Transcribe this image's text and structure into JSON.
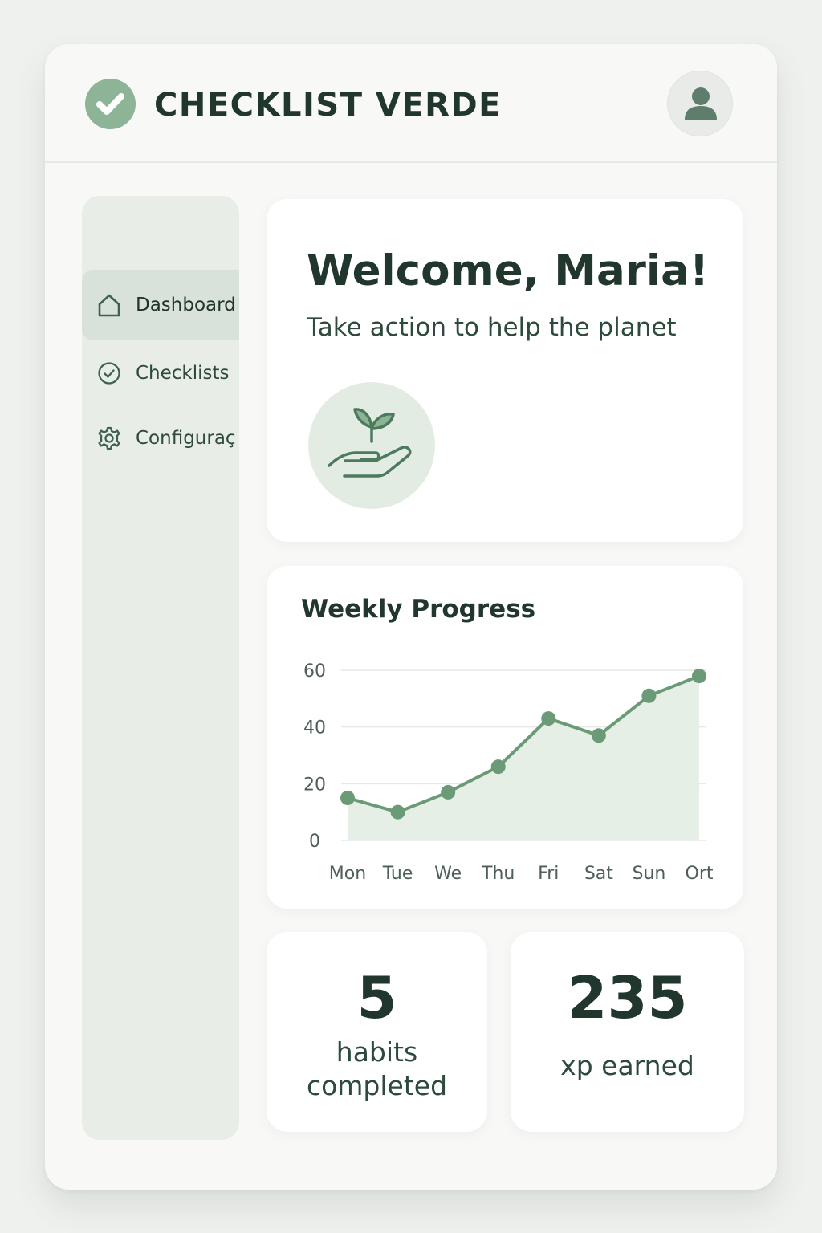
{
  "header": {
    "title": "CHECKLIST VERDE",
    "logo_icon": "check-circle-icon",
    "avatar_icon": "user-icon"
  },
  "sidebar": {
    "items": [
      {
        "label": "Dashboard",
        "icon": "home-icon",
        "active": true
      },
      {
        "label": "Checklists",
        "icon": "check-circle-icon",
        "active": false
      },
      {
        "label": "Configuraç",
        "icon": "gear-icon",
        "active": false
      }
    ]
  },
  "welcome": {
    "title": "Welcome, Maria!",
    "subtitle": "Take action to help the planet",
    "illustration_icon": "seedling-in-hand-icon"
  },
  "progress": {
    "title": "Weekly Progress"
  },
  "chart_data": {
    "type": "area",
    "title": "Weekly Progress",
    "categories": [
      "Mon",
      "Tue",
      "We",
      "Thu",
      "Fri",
      "Sat",
      "Sun",
      "Ort"
    ],
    "values": [
      15,
      10,
      17,
      26,
      43,
      37,
      51,
      58
    ],
    "yticks": [
      0,
      20,
      40,
      60
    ],
    "ylim": [
      0,
      60
    ],
    "grid": true,
    "xlabel": "",
    "ylabel": ""
  },
  "stats": {
    "habits_value": "5",
    "habits_label_line1": "habits",
    "habits_label_line2": "completed",
    "xp_value": "235",
    "xp_label": "xp earned"
  },
  "colors": {
    "accent": "#6b9a76",
    "accent_light": "#8db497",
    "area_fill": "#e6efe5",
    "text_dark": "#21362d",
    "sidebar_bg": "#e8ede8"
  }
}
